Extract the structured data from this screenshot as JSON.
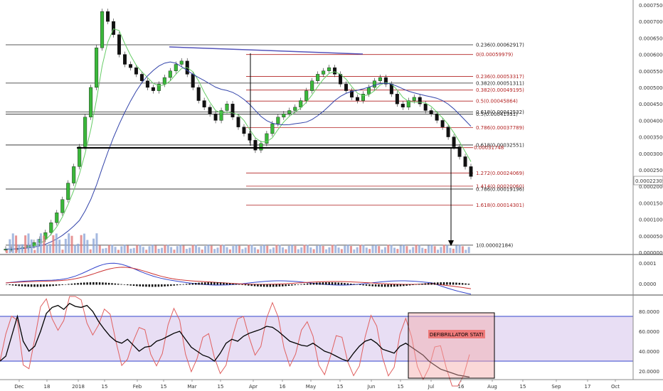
{
  "chart_data": {
    "type": "candlestick",
    "price_axis": {
      "ticks": [
        "0.00075000",
        "0.00070000",
        "0.00065000",
        "0.00060000",
        "0.00055000",
        "0.00050000",
        "0.00045000",
        "0.00040000",
        "0.00035000",
        "0.00030000",
        "0.00025000",
        "0.00020000",
        "0.00015000",
        "0.00010000",
        "0.00005000",
        "0.00000000"
      ],
      "ylim": [
        0.0,
        0.000765
      ],
      "last_price_label": "0.00022305",
      "last_price": 0.00022305
    },
    "time_axis": {
      "ticks": [
        "Dec",
        "18",
        "2018",
        "15",
        "Feb",
        "15",
        "Mar",
        "15",
        "Apr",
        "16",
        "May",
        "15",
        "Jun",
        "15",
        "Jul",
        "16",
        "Aug",
        "15",
        "Sep",
        "17",
        "Oct"
      ]
    },
    "macd_axis": {
      "ticks": [
        "0.0001",
        "0.0000"
      ]
    },
    "rsi_axis": {
      "ticks": [
        "80.0000",
        "60.0000",
        "40.0000",
        "20.0000"
      ]
    },
    "fib_levels": [
      {
        "label": "0.236(0.00062917)",
        "value": 0.00062917,
        "color": "#222222"
      },
      {
        "label": "0(0.00059979)",
        "value": 0.00059979,
        "color": "#b22222"
      },
      {
        "label": "0.236(0.00053317)",
        "value": 0.00053317,
        "color": "#b22222"
      },
      {
        "label": "0.382(0.00051311)",
        "value": 0.00051311,
        "color": "#222222"
      },
      {
        "label": "0.382(0.00049195)",
        "value": 0.00049195,
        "color": "#b22222"
      },
      {
        "label": "0.5(0.00045864)",
        "value": 0.00045864,
        "color": "#b22222"
      },
      {
        "label": "0.618(0.00042532)",
        "value": 0.00042532,
        "color": "#222222"
      },
      {
        "label": "0.5(0.00041931)",
        "value": 0.00041931,
        "color": "#222222"
      },
      {
        "label": "0.786(0.00037789)",
        "value": 0.00037789,
        "color": "#b22222"
      },
      {
        "label": "0.618(0.00032551)",
        "value": 0.00032551,
        "color": "#222222"
      },
      {
        "label": "0.00031748",
        "value": 0.00031748,
        "color": "#b22222"
      },
      {
        "label": "1.272(0.00024069)",
        "value": 0.00024069,
        "color": "#b22222"
      },
      {
        "label": "1.414(0.00020060)",
        "value": 0.0002006,
        "color": "#b22222"
      },
      {
        "label": "0.786(0.00019196)",
        "value": 0.00019196,
        "color": "#222222"
      },
      {
        "label": "1.618(0.00014301)",
        "value": 0.00014301,
        "color": "#b22222"
      },
      {
        "label": "1(0.00002184)",
        "value": 2.184e-05,
        "color": "#222222"
      }
    ],
    "annotation": "DEFIBRILLATOR STAT!",
    "series": [
      {
        "name": "price",
        "close": [
          1e-05,
          1e-05,
          1.2e-05,
          1.5e-05,
          2e-05,
          3e-05,
          4e-05,
          6e-05,
          9e-05,
          0.00012,
          0.00016,
          0.00021,
          0.00026,
          0.00032,
          0.00041,
          0.0005,
          0.00062,
          0.00073,
          0.0007,
          0.00066,
          0.0006,
          0.00057,
          0.00056,
          0.00054,
          0.00052,
          0.0005,
          0.00049,
          0.00051,
          0.00053,
          0.00055,
          0.00057,
          0.00058,
          0.00054,
          0.0005,
          0.00046,
          0.00044,
          0.00042,
          0.0004,
          0.00043,
          0.00045,
          0.00041,
          0.00038,
          0.00036,
          0.00034,
          0.00031,
          0.00033,
          0.00036,
          0.00039,
          0.00041,
          0.00042,
          0.00043,
          0.00044,
          0.00046,
          0.00049,
          0.00052,
          0.00054,
          0.00055,
          0.00056,
          0.00054,
          0.00051,
          0.00049,
          0.00047,
          0.00046,
          0.00048,
          0.0005,
          0.00052,
          0.00053,
          0.00051,
          0.00048,
          0.00045,
          0.00044,
          0.00046,
          0.00047,
          0.00045,
          0.00043,
          0.00042,
          0.0004,
          0.00038,
          0.00035,
          0.00032,
          0.00029,
          0.00026,
          0.00023
        ]
      },
      {
        "name": "rsi",
        "values": [
          30,
          35,
          55,
          75,
          50,
          40,
          45,
          60,
          78,
          84,
          86,
          82,
          88,
          85,
          84,
          86,
          80,
          70,
          62,
          55,
          50,
          48,
          52,
          46,
          40,
          44,
          45,
          50,
          52,
          55,
          58,
          60,
          52,
          44,
          40,
          36,
          34,
          30,
          38,
          48,
          52,
          50,
          55,
          58,
          60,
          62,
          65,
          64,
          60,
          55,
          50,
          48,
          46,
          45,
          48,
          44,
          40,
          38,
          35,
          32,
          30,
          38,
          45,
          50,
          52,
          48,
          42,
          40,
          38,
          45,
          48,
          44,
          40,
          36,
          30,
          26,
          22,
          20,
          18,
          16,
          15,
          14
        ]
      }
    ]
  }
}
